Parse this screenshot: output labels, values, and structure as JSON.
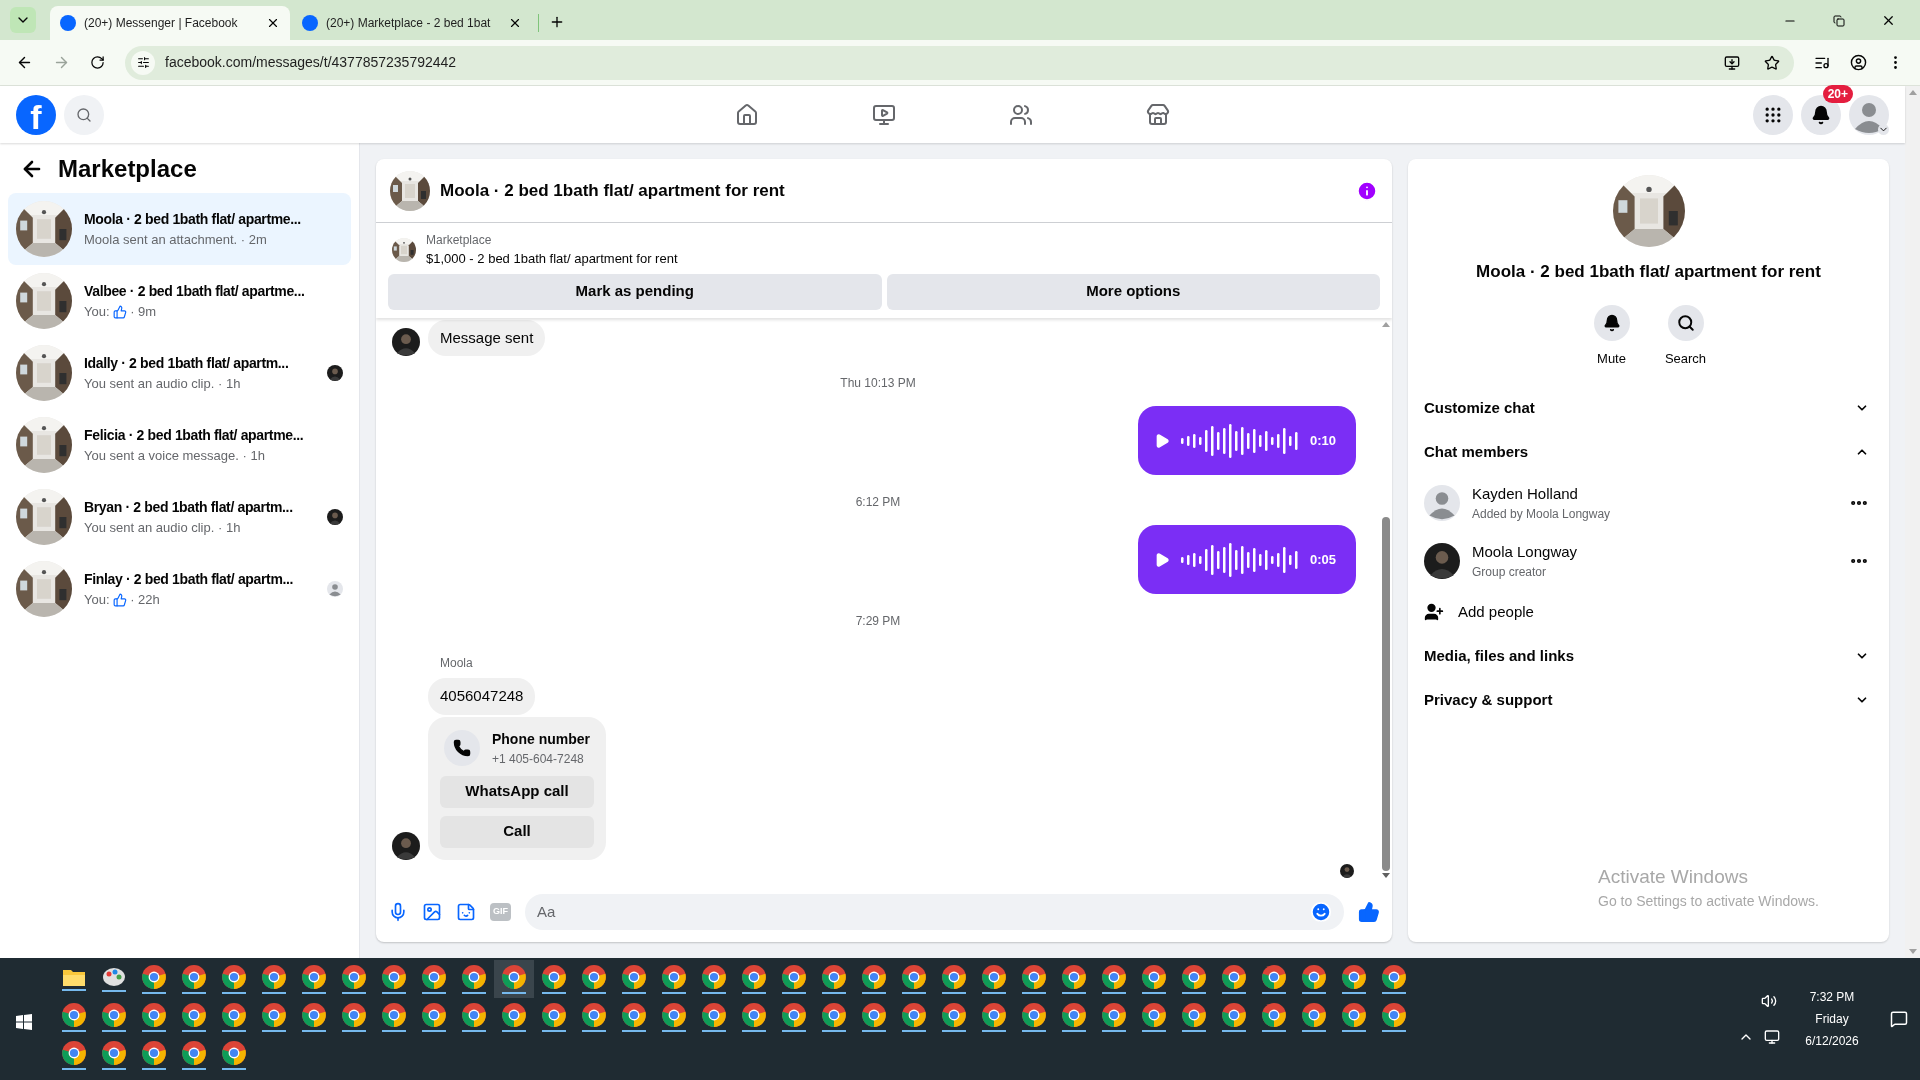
{
  "browser": {
    "tabs": [
      {
        "title": "(20+) Messenger | Facebook",
        "selected": true
      },
      {
        "title": "(20+) Marketplace - 2 bed 1bat",
        "selected": false
      }
    ],
    "url": "facebook.com/messages/t/4377857235792442"
  },
  "header": {
    "logo_text": "f",
    "notification_badge": "20+"
  },
  "sidebar": {
    "title": "Marketplace",
    "conversations": [
      {
        "name": "Moola · 2 bed 1bath flat/ apartme...",
        "preview": "Moola sent an attachment.",
        "like": false,
        "time": " · 2m",
        "selected": true
      },
      {
        "name": "Valbee · 2 bed 1bath flat/ apartme...",
        "preview": "You:",
        "like": true,
        "time": " · 9m",
        "selected": false
      },
      {
        "name": "Idally · 2 bed 1bath flat/ apartm...",
        "preview": "You sent an audio clip.",
        "like": false,
        "time": " · 1h",
        "selected": false
      },
      {
        "name": "Felicia · 2 bed 1bath flat/ apartme...",
        "preview": "You sent a voice message.",
        "like": false,
        "time": " · 1h",
        "selected": false
      },
      {
        "name": "Bryan · 2 bed 1bath flat/ apartm...",
        "preview": "You sent an audio clip.",
        "like": false,
        "time": " · 1h",
        "selected": false
      },
      {
        "name": "Finlay · 2 bed 1bath flat/ apartm...",
        "preview": "You:",
        "like": true,
        "time": " · 22h",
        "seen_by": {
          "kind": "default"
        },
        "selected": false
      }
    ]
  },
  "chat": {
    "title": "Moola · 2 bed 1bath flat/ apartment for rent",
    "listing": {
      "label": "Marketplace",
      "text": "$1,000 - 2 bed 1bath flat/ apartment for rent",
      "buttons": [
        "Mark as pending",
        "More options"
      ]
    },
    "messages": [
      {
        "kind": "text",
        "text": "Message sent",
        "avatar": true
      },
      {
        "kind": "time",
        "text": "Thu 10:13 PM"
      },
      {
        "kind": "audio",
        "duration": "0:10"
      },
      {
        "kind": "time",
        "text": "6:12 PM"
      },
      {
        "kind": "audio",
        "duration": "0:05"
      },
      {
        "kind": "time",
        "text": "7:29 PM"
      },
      {
        "kind": "sender",
        "text": "Moola"
      },
      {
        "kind": "text",
        "text": "4056047248",
        "avatar": false
      },
      {
        "kind": "contact",
        "title": "Phone number",
        "number": "+1 405-604-7248",
        "buttons": [
          "WhatsApp call",
          "Call"
        ],
        "avatar": true
      }
    ],
    "composer": {
      "gif_label": "GIF",
      "placeholder": "Aa"
    }
  },
  "details": {
    "title": "Moola · 2 bed 1bath flat/ apartment for rent",
    "actions": [
      "Mute",
      "Search"
    ],
    "sections": [
      {
        "title": "Customize chat",
        "expanded": false
      },
      {
        "title": "Chat members",
        "expanded": true,
        "members": [
          {
            "name": "Kayden Holland",
            "note": "Added by Moola Longway",
            "kind": "default"
          },
          {
            "name": "Moola Longway",
            "note": "Group creator"
          }
        ],
        "add_label": "Add people"
      },
      {
        "title": "Media, files and links",
        "expanded": false
      },
      {
        "title": "Privacy & support",
        "expanded": false
      }
    ]
  },
  "activation": {
    "title": "Activate Windows",
    "text": "Go to Settings to activate Windows."
  },
  "taskbar": {
    "time": "7:32 PM",
    "day": "Friday",
    "date": "6/12/2026"
  }
}
